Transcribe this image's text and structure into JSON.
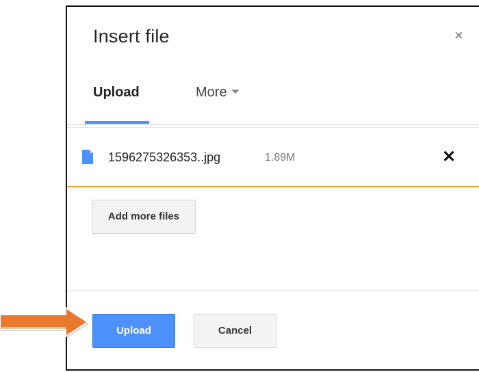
{
  "dialog": {
    "title": "Insert file",
    "close_glyph": "×"
  },
  "tabs": [
    {
      "label": "Upload",
      "active": true
    },
    {
      "label": "More",
      "active": false
    }
  ],
  "file": {
    "name": "1596275326353..jpg",
    "size": "1.89M",
    "remove_glyph": "✕",
    "icon": "file-icon"
  },
  "buttons": {
    "add_more": "Add more files",
    "upload": "Upload",
    "cancel": "Cancel"
  },
  "annotation": {
    "icon": "arrow-right-icon",
    "color": "#e8792d"
  },
  "colors": {
    "accent": "#4d90fe",
    "selected_border": "#f1a02e"
  }
}
